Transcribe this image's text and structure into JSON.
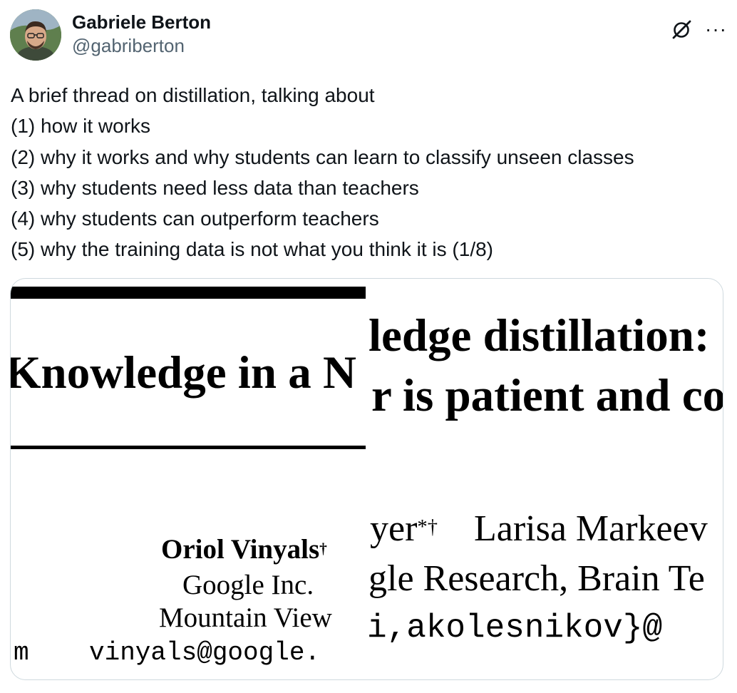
{
  "author": {
    "display_name": "Gabriele Berton",
    "handle": "@gabriberton"
  },
  "actions": {
    "grok_icon": "grok-icon",
    "more_label": "···"
  },
  "tweet": {
    "lines": [
      "A brief thread on distillation, talking about",
      "(1) how it works",
      "(2) why it works and why students can learn to classify unseen classes",
      "(3) why students need less data than teachers",
      "(4) why students can outperform teachers",
      "(5) why the training data is not what you think it is (1/8)"
    ]
  },
  "media": {
    "left_image": {
      "title": "Knowledge in a N",
      "author": "Oriol Vinyals",
      "author_mark": "†",
      "affiliation": "Google Inc.",
      "location": "Mountain View",
      "email_prefix": "m",
      "email": "vinyals@google."
    },
    "right_image": {
      "title_line1": "ledge distillation:",
      "title_line2": "r is patient and co",
      "author_prev": "yer",
      "author_prev_mark": "*†",
      "author": "Larisa Markeev",
      "affiliation": "gle Research, Brain Te",
      "email": "i,akolesnikov}@"
    }
  }
}
